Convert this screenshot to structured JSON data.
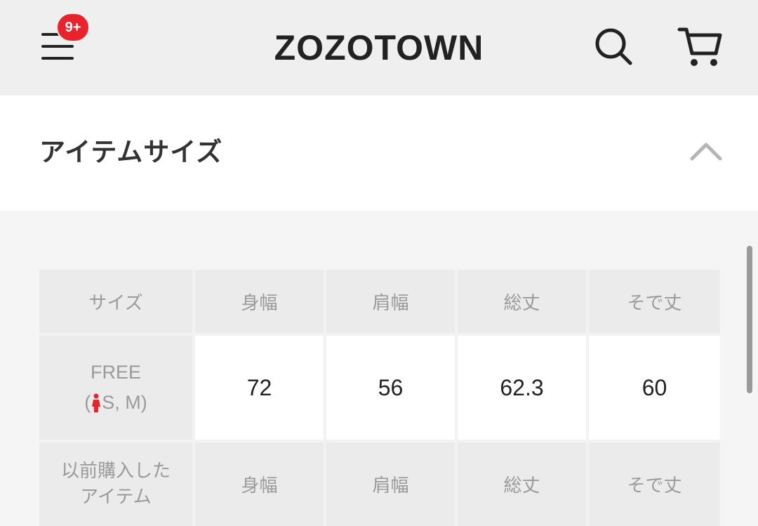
{
  "header": {
    "badge": "9+",
    "logo": "ZOZOTOWN",
    "icons": {
      "menu": "hamburger-menu-icon",
      "search": "search-icon",
      "cart": "cart-icon"
    }
  },
  "section": {
    "title": "アイテムサイズ",
    "expanded": true,
    "toggle_icon": "chevron-up-icon"
  },
  "size_table": {
    "headers": [
      "サイズ",
      "身幅",
      "肩幅",
      "総丈",
      "そで丈"
    ],
    "rows": [
      {
        "size": "FREE",
        "size_note_open": "(",
        "size_note": "S, M",
        "size_note_close": ")",
        "values": [
          "72",
          "56",
          "62.3",
          "60"
        ]
      }
    ],
    "previous_item": {
      "label_line1": "以前購入した",
      "label_line2": "アイテム",
      "columns": [
        "身幅",
        "肩幅",
        "総丈",
        "そで丈"
      ]
    }
  },
  "colors": {
    "badge": "#e8232b",
    "header_bg": "#efefef",
    "person_icon": "#e8232b"
  }
}
